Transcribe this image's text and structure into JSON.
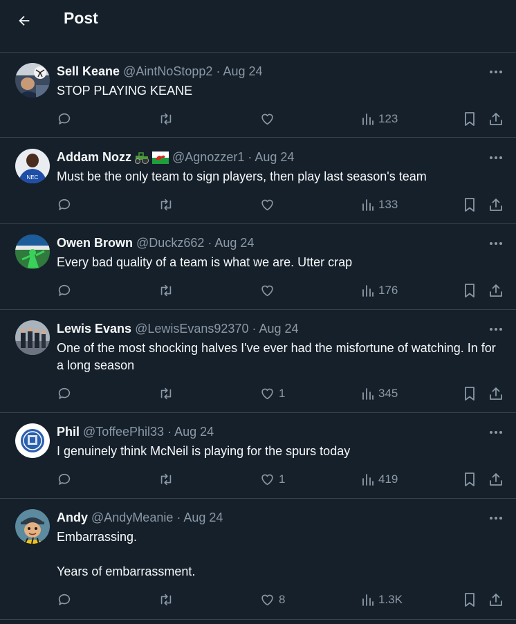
{
  "header": {
    "title": "Post"
  },
  "tweets": [
    {
      "name": "Sell Keane",
      "handle": "@AintNoStopp2",
      "date": "Aug 24",
      "text": "STOP PLAYING KEANE",
      "likes": "",
      "views": "123"
    },
    {
      "name": "Addam Nozz",
      "handle": "@Agnozzer1",
      "date": "Aug 24",
      "text": "Must be the only team to sign players, then play last season's team",
      "likes": "",
      "views": "133",
      "avatar_text": "NEC"
    },
    {
      "name": "Owen Brown",
      "handle": "@Duckz662",
      "date": "Aug 24",
      "text": "Every bad quality of a team is what we are. Utter crap",
      "likes": "",
      "views": "176"
    },
    {
      "name": "Lewis Evans",
      "handle": "@LewisEvans92370",
      "date": "Aug 24",
      "text": "One of the most shocking halves I've ever had the misfortune of watching. In for a long season",
      "likes": "1",
      "views": "345"
    },
    {
      "name": "Phil",
      "handle": "@ToffeePhil33",
      "date": "Aug 24",
      "text": "I genuinely think McNeil is playing for the spurs today",
      "likes": "1",
      "views": "419"
    },
    {
      "name": "Andy",
      "handle": "@AndyMeanie",
      "date": "Aug 24",
      "text": "Embarrassing.\n\nYears of embarrassment.",
      "likes": "8",
      "views": "1.3K"
    }
  ],
  "dot": "·",
  "colors": {
    "background": "#15202b",
    "muted": "#8b98a5",
    "divider": "#38444d",
    "text": "#f7f9f9"
  },
  "icons": [
    "back-arrow-icon",
    "more-icon",
    "reply-icon",
    "retweet-icon",
    "like-icon",
    "views-icon",
    "bookmark-icon",
    "share-icon"
  ]
}
